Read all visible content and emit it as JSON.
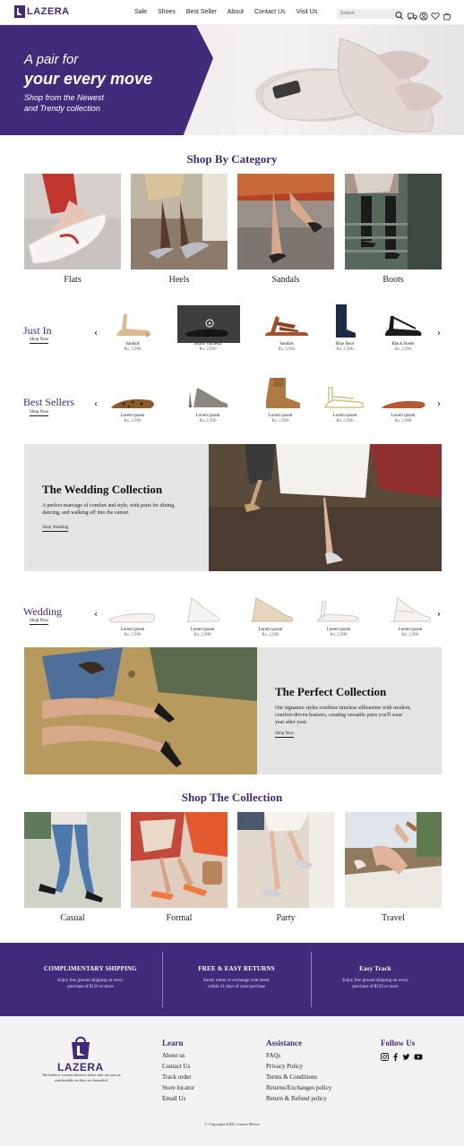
{
  "brand": {
    "name": "LAZERA",
    "tagline": "We believe women deserve shoes that are just as comfortable as they are beautiful.",
    "accent": "#3f2b7a"
  },
  "nav": {
    "items": [
      "Sale",
      "Shoes",
      "Best Seller",
      "About",
      "Contact Us",
      "Visit Us"
    ],
    "search_placeholder": "Search"
  },
  "header_icons": [
    "search-icon",
    "truck-icon",
    "user-icon",
    "heart-icon",
    "bag-icon"
  ],
  "hero": {
    "line1": "A pair for",
    "line2": "your every move",
    "sub1": "Shop from the Newest",
    "sub2": "and Trendy collection"
  },
  "shop_by_category": {
    "title": "Shop By Category",
    "items": [
      "Flats",
      "Heels",
      "Sandals",
      "Boots"
    ]
  },
  "just_in": {
    "title": "Just In",
    "link": "Shop Now",
    "products": [
      {
        "name": "Sandals",
        "price": "Rs. 2,990"
      },
      {
        "name": "Black Vachetta",
        "price": "Rs. 2,990"
      },
      {
        "name": "Sandals",
        "price": "Rs. 2,990"
      },
      {
        "name": "Blue Boot",
        "price": "Rs. 2,990"
      },
      {
        "name": "Black Suede",
        "price": "Rs. 2,990"
      }
    ]
  },
  "best_sellers": {
    "title": "Best Sellers",
    "link": "Shop Now",
    "products": [
      {
        "name": "Lorem ipsum",
        "price": "Rs. 2,990"
      },
      {
        "name": "Lorem ipsum",
        "price": "Rs. 2,990"
      },
      {
        "name": "Lorem ipsum",
        "price": "Rs. 2,990"
      },
      {
        "name": "Lorem ipsum",
        "price": "Rs. 2,990"
      },
      {
        "name": "Lorem ipsum",
        "price": "Rs. 2,990"
      }
    ]
  },
  "wedding_collection": {
    "title": "The Wedding Collection",
    "text1": "A perfect marriage of comfort and style, with pairs for dining,",
    "text2": "dancing, and walking off into the sunset.",
    "link": "Shop Wedding"
  },
  "wedding": {
    "title": "Wedding",
    "link": "Shop Now",
    "products": [
      {
        "name": "Lorem ipsum",
        "price": "Rs. 2,990"
      },
      {
        "name": "Lorem ipsum",
        "price": "Rs. 2,990"
      },
      {
        "name": "Lorem ipsum",
        "price": "Rs. 2,990"
      },
      {
        "name": "Lorem ipsum",
        "price": "Rs. 2,990"
      },
      {
        "name": "Lorem ipsum",
        "price": "Rs. 2,990"
      }
    ]
  },
  "perfect_collection": {
    "title": "The Perfect Collection",
    "text1": "Our signature styles combine timeless silhouettes with modern,",
    "text2": "comfort-driven features, creating versatile pairs you'll wear",
    "text3": "year after year.",
    "link": "Shop Now"
  },
  "shop_the_collection": {
    "title": "Shop The Collection",
    "items": [
      "Casual",
      "Formal",
      "Party",
      "Travel"
    ]
  },
  "benefits": [
    {
      "title": "COMPLIMENTARY SHIPPING",
      "line1": "Enjoy free ground shipping on every",
      "line2": "purchase of $150 or more"
    },
    {
      "title": "FREE & EASY RETURNS",
      "line1": "Easily return or exchange your items",
      "line2": "within 21 days of your purchase"
    },
    {
      "title": "Easy Track",
      "line1": "Enjoy free ground shipping on every",
      "line2": "purchase of $150 or more"
    }
  ],
  "footer": {
    "learn": {
      "title": "Learn",
      "links": [
        "About us",
        "Contact Us",
        "Track order",
        "Store locator",
        "Email Us"
      ]
    },
    "assistance": {
      "title": "Assistance",
      "links": [
        "FAQs",
        "Privacy Policy",
        "Terms & Conditions",
        "Returns/Exchanges policy",
        "Return & Refund policy"
      ]
    },
    "follow": {
      "title": "Follow Us",
      "icons": [
        "instagram-icon",
        "facebook-icon",
        "twitter-icon",
        "youtube-icon"
      ]
    },
    "copyright": "© Copyright 2020 | Lazera Moves"
  }
}
